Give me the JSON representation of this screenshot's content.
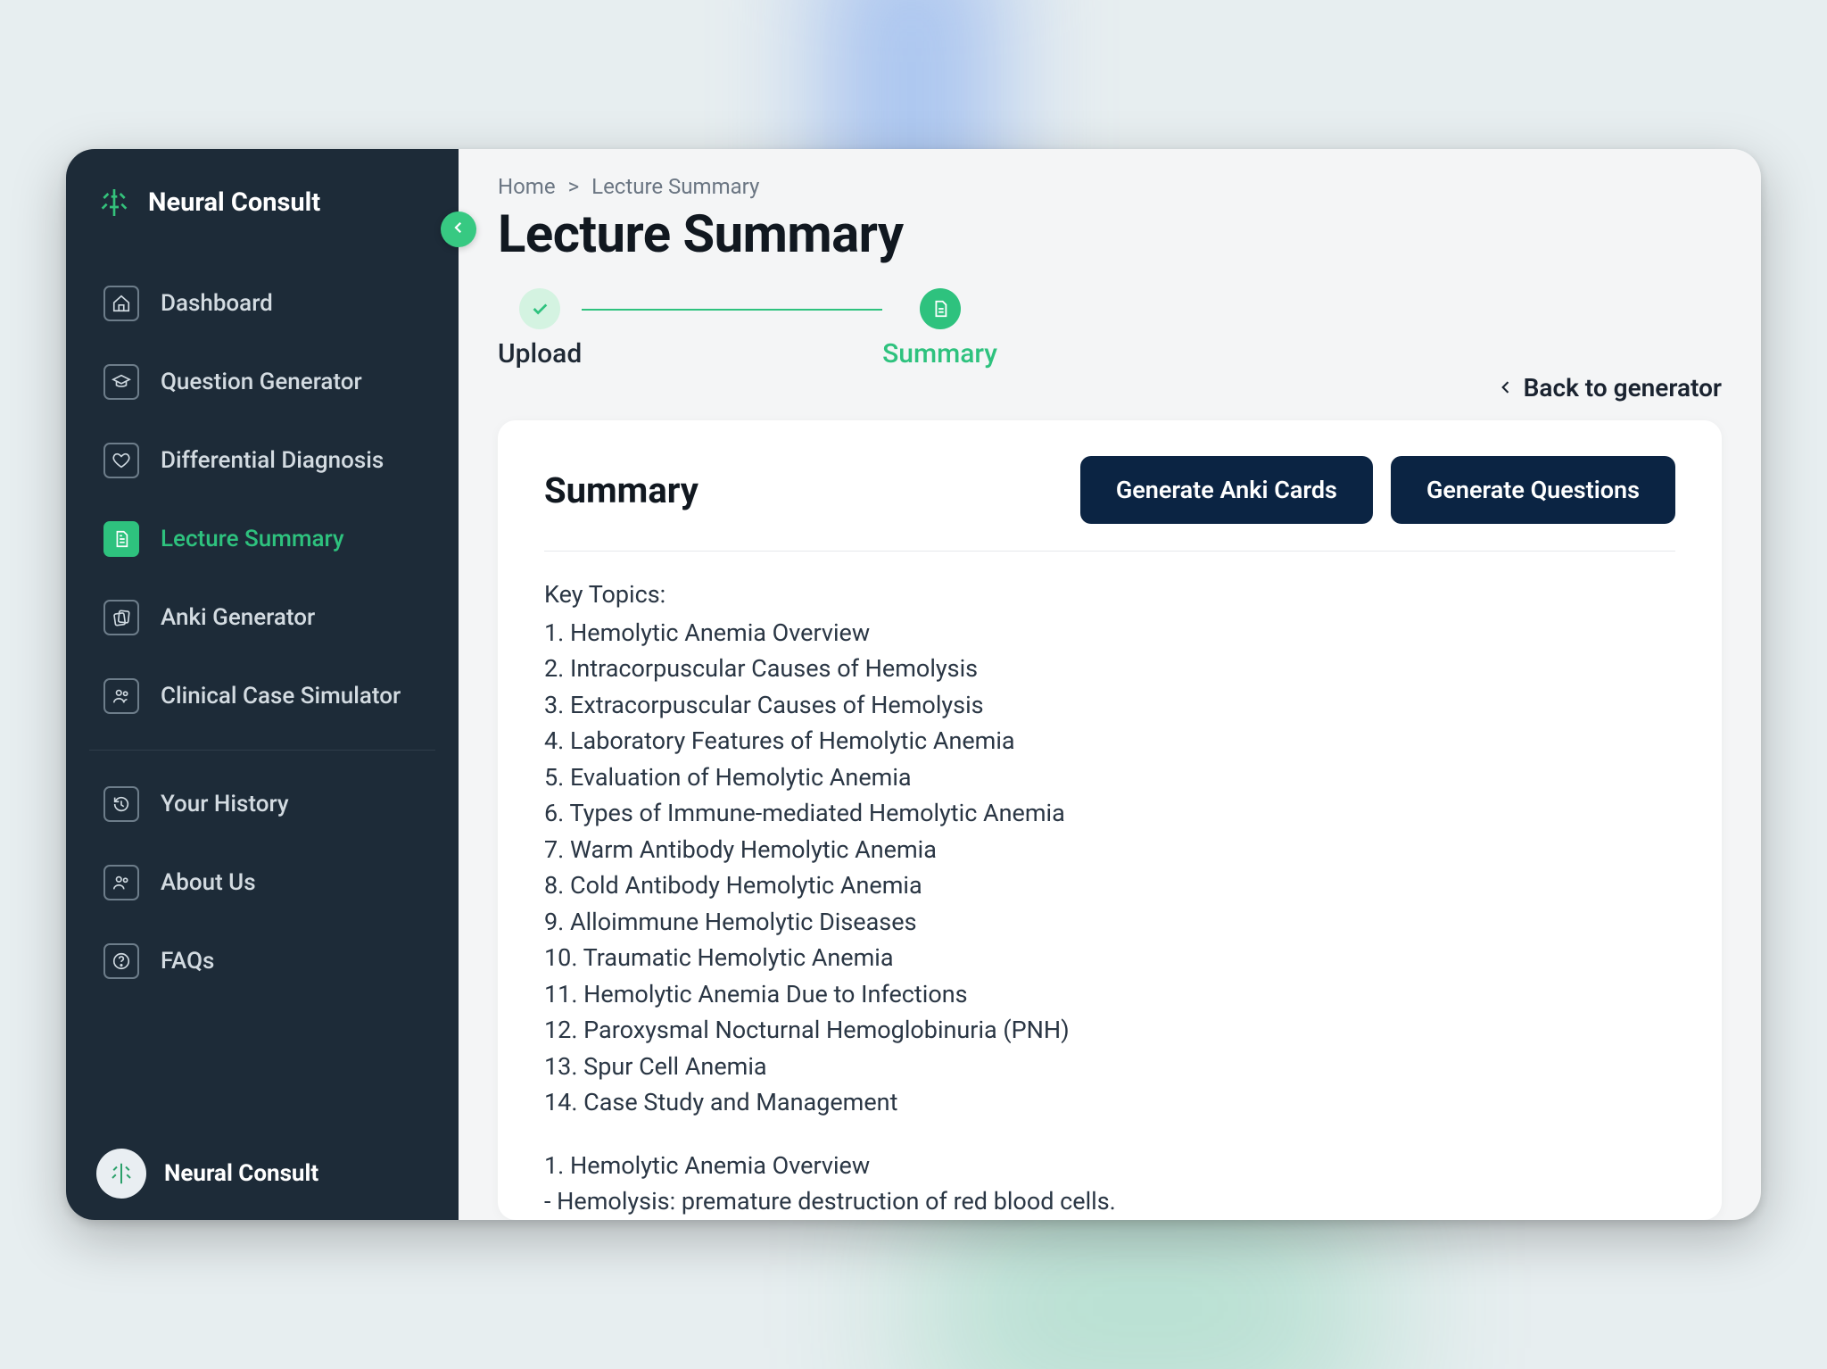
{
  "brand": {
    "name": "Neural Consult"
  },
  "collapse_aria": "collapse",
  "sidebar": {
    "items": [
      {
        "label": "Dashboard",
        "icon": "home-icon"
      },
      {
        "label": "Question Generator",
        "icon": "grad-cap-icon"
      },
      {
        "label": "Differential Diagnosis",
        "icon": "heart-icon"
      },
      {
        "label": "Lecture Summary",
        "icon": "file-icon",
        "active": true
      },
      {
        "label": "Anki Generator",
        "icon": "cards-icon"
      },
      {
        "label": "Clinical Case Simulator",
        "icon": "people-icon"
      }
    ],
    "secondary": [
      {
        "label": "Your History",
        "icon": "history-icon"
      },
      {
        "label": "About Us",
        "icon": "people-icon"
      },
      {
        "label": "FAQs",
        "icon": "help-icon"
      }
    ],
    "footer_name": "Neural Consult"
  },
  "breadcrumb": {
    "home": "Home",
    "separator": ">",
    "current": "Lecture Summary"
  },
  "page_title": "Lecture Summary",
  "stepper": {
    "step1": "Upload",
    "step2": "Summary"
  },
  "backlink": "Back to generator",
  "card": {
    "title": "Summary",
    "btn_anki": "Generate Anki Cards",
    "btn_questions": "Generate Questions"
  },
  "summary": {
    "heading": "Key Topics:",
    "topics": [
      "1. Hemolytic Anemia Overview",
      "2. Intracorpuscular Causes of Hemolysis",
      "3. Extracorpuscular Causes of Hemolysis",
      "4. Laboratory Features of Hemolytic Anemia",
      "5. Evaluation of Hemolytic Anemia",
      "6. Types of Immune-mediated Hemolytic Anemia",
      "7. Warm Antibody Hemolytic Anemia",
      "8. Cold Antibody Hemolytic Anemia",
      "9. Alloimmune Hemolytic Diseases",
      "10. Traumatic Hemolytic Anemia",
      "11. Hemolytic Anemia Due to Infections",
      "12. Paroxysmal Nocturnal Hemoglobinuria (PNH)",
      "13. Spur Cell Anemia",
      "14. Case Study and Management"
    ],
    "section1_title": "1. Hemolytic Anemia Overview",
    "section1_bullet1": "- Hemolysis: premature destruction of red blood cells."
  }
}
